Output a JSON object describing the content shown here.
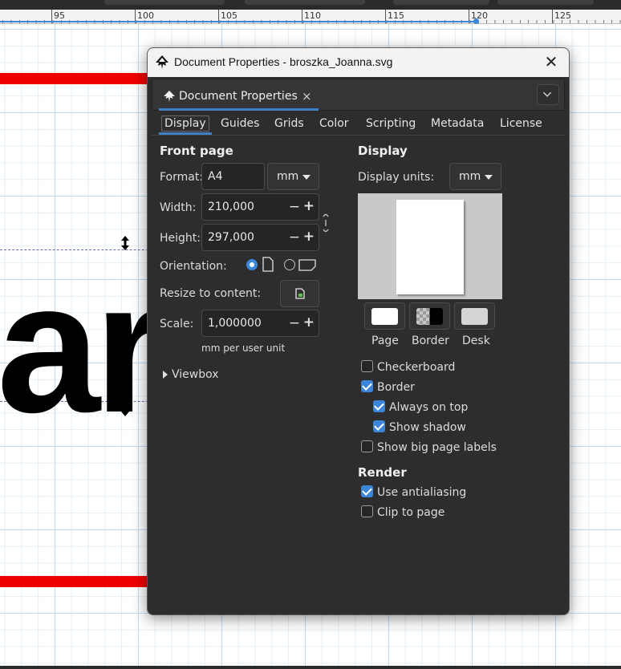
{
  "ruler": {
    "ticks": [
      "95",
      "100",
      "105",
      "110",
      "115",
      "120",
      "125"
    ]
  },
  "canvas": {
    "text": "ar"
  },
  "dialog": {
    "title": "Document Properties - broszka_Joanna.svg",
    "close_glyph": "✕",
    "dock_tab": {
      "label": "Document Properties",
      "close_glyph": "×"
    },
    "tabs": [
      "Display",
      "Guides",
      "Grids",
      "Color",
      "Scripting",
      "Metadata",
      "License"
    ],
    "front_page": {
      "heading": "Front page",
      "format_label": "Format:",
      "format_value": "A4",
      "unit_value": "mm",
      "width_label": "Width:",
      "width_value": "210,000",
      "height_label": "Height:",
      "height_value": "297,000",
      "orientation_label": "Orientation:",
      "resize_label": "Resize to content:",
      "scale_label": "Scale:",
      "scale_value": "1,000000",
      "scale_unit": "mm per user unit",
      "viewbox_label": "Viewbox",
      "stepper_minus": "−",
      "stepper_plus": "+"
    },
    "display": {
      "heading": "Display",
      "units_label": "Display units:",
      "units_value": "mm",
      "swatches": [
        "Page",
        "Border",
        "Desk"
      ],
      "checkboxes": [
        {
          "label": "Checkerboard",
          "checked": false
        },
        {
          "label": "Border",
          "checked": true
        },
        {
          "label": "Always on top",
          "checked": true
        },
        {
          "label": "Show shadow",
          "checked": true
        },
        {
          "label": "Show big page labels",
          "checked": false
        }
      ]
    },
    "render": {
      "heading": "Render",
      "checkboxes": [
        {
          "label": "Use antialiasing",
          "checked": true
        },
        {
          "label": "Clip to page",
          "checked": false
        }
      ]
    }
  },
  "colors": {
    "accent": "#3b86d8",
    "dialog_bg": "#2d2d2d",
    "guide_red": "#ee0000"
  }
}
